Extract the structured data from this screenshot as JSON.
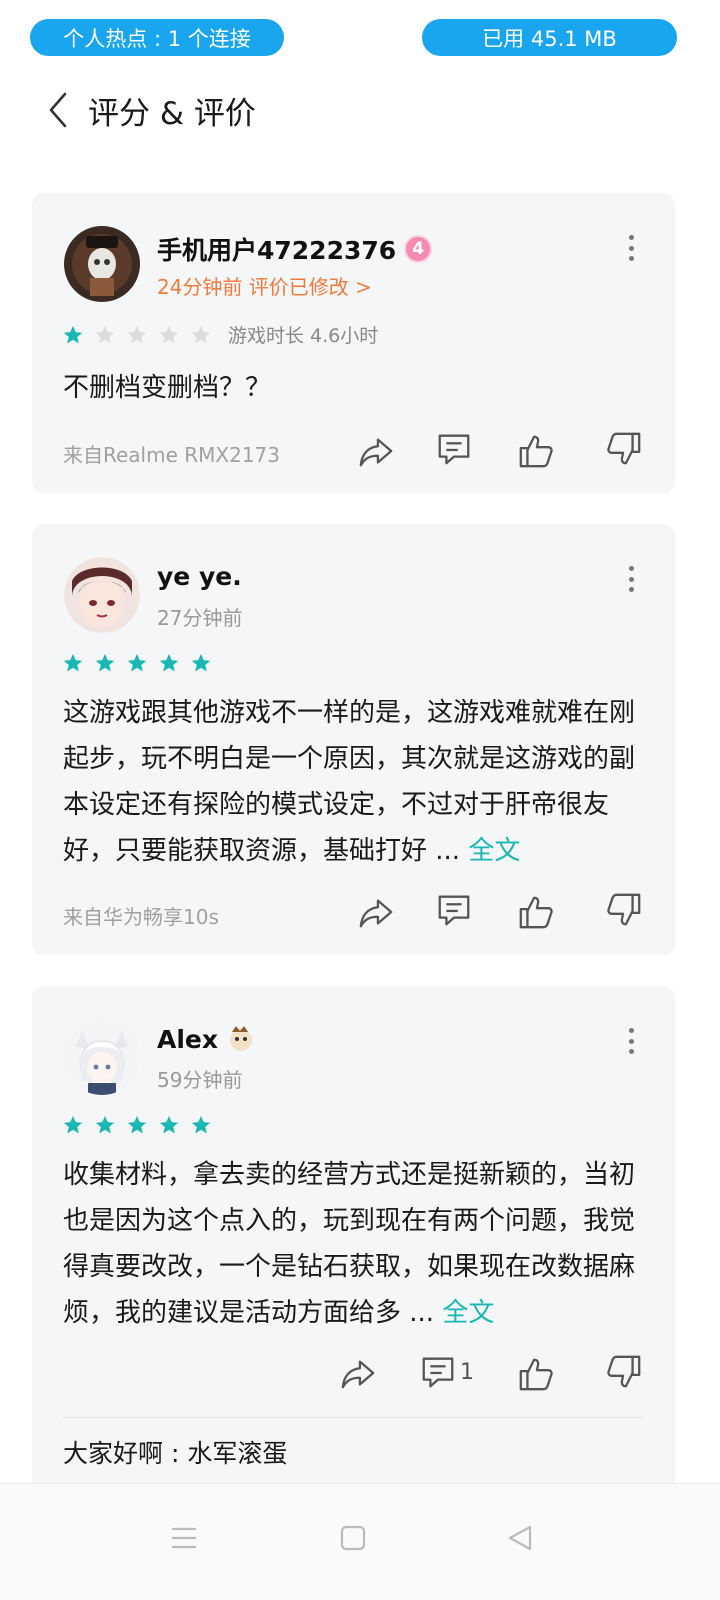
{
  "status": {
    "hotspot": "个人热点 : 1 个连接",
    "usage": "已用 45.1 MB"
  },
  "header": {
    "title": "评分 & 评价"
  },
  "colors": {
    "accent": "#19b8b3",
    "status_pill": "#1aa6ef",
    "edited": "#f07a3b",
    "star_off": "#d9d9d9"
  },
  "reviews": [
    {
      "username": "手机用户47222376",
      "badge": "4",
      "time": "24分钟前",
      "edited": "评价已修改 >",
      "rating": 1,
      "playtime": "游戏时长 4.6小时",
      "text": "不删档变删档？？",
      "device": "来自Realme RMX2173"
    },
    {
      "username": "ye ye.",
      "time": "27分钟前",
      "rating": 5,
      "text": "这游戏跟其他游戏不一样的是，这游戏难就难在刚起步，玩不明白是一个原因，其次就是这游戏的副本设定还有探险的模式设定，不过对于肝帝很友好，只要能获取资源，基础打好 ...",
      "more": "全文",
      "device": "来自华为畅享10s"
    },
    {
      "username": "Alex",
      "time": "59分钟前",
      "rating": 5,
      "text": "收集材料，拿去卖的经营方式还是挺新颖的，当初也是因为这个点入的，玩到现在有两个问题，我觉得真要改改，一个是钻石获取，如果现在改数据麻烦，我的建议是活动方面给多 ...",
      "more": "全文",
      "comment_count": "1",
      "reply": "大家好啊 : 水军滚蛋"
    }
  ],
  "icons": [
    "back-icon",
    "more-icon",
    "share-icon",
    "comment-icon",
    "thumbs-up-icon",
    "thumbs-down-icon",
    "menu-icon",
    "home-icon",
    "nav-back-icon"
  ]
}
